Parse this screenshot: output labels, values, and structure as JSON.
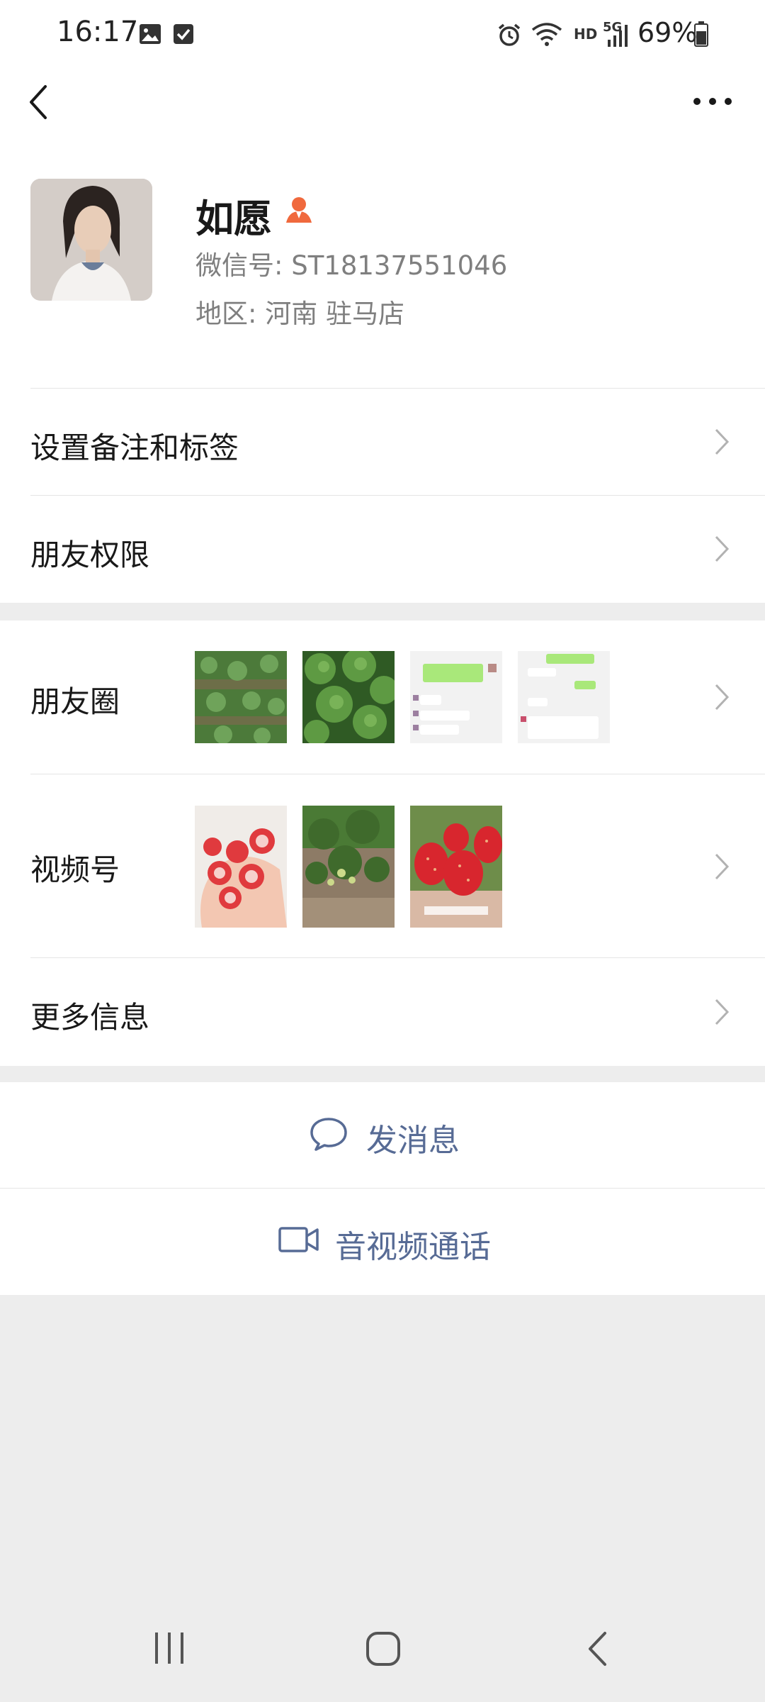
{
  "status_bar": {
    "time": "16:17",
    "battery": "69%",
    "network": "5G",
    "hd": "HD",
    "icons": [
      "image-icon",
      "check-icon",
      "alarm-icon",
      "wifi-icon",
      "signal-icon",
      "battery-icon"
    ]
  },
  "nav": {
    "back_icon": "back-icon",
    "more_icon": "more-icon"
  },
  "profile": {
    "name": "如愿",
    "gender_icon": "female-icon",
    "wechat_id": "微信号: ST18137551046",
    "region": "地区: 河南  驻马店"
  },
  "menu": {
    "remarks_tags": "设置备注和标签",
    "friend_permissions": "朋友权限",
    "moments": "朋友圈",
    "channels": "视频号",
    "more_info": "更多信息"
  },
  "actions": {
    "send_message": "发消息",
    "av_call": "音视频通话"
  },
  "colors": {
    "link": "#576b95",
    "background": "#ededed",
    "female_icon": "#f0693d"
  }
}
